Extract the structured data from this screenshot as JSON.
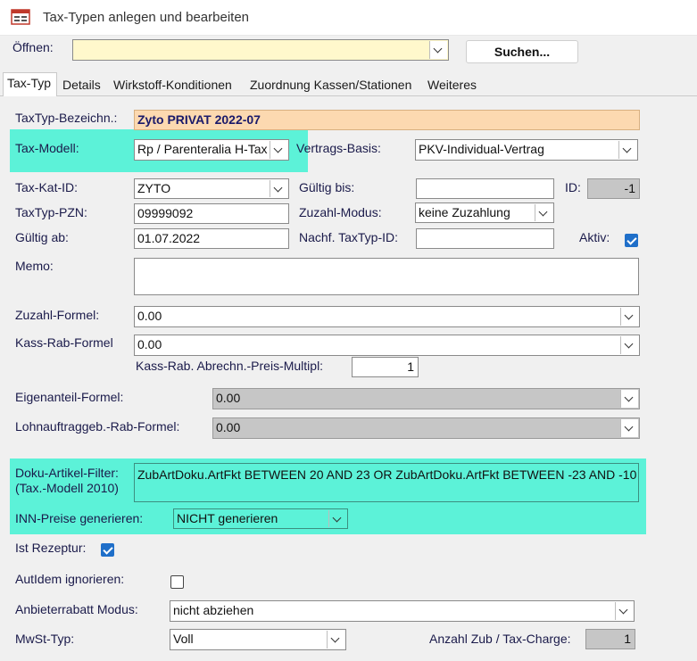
{
  "window": {
    "title": "Tax-Typen anlegen und bearbeiten"
  },
  "toolbar": {
    "open_label": "Öffnen:",
    "open_value": "",
    "search_button": "Suchen..."
  },
  "tabs": [
    {
      "label": "Tax-Typ"
    },
    {
      "label": "Details"
    },
    {
      "label": "Wirkstoff-Konditionen"
    },
    {
      "label": "Zuordnung Kassen/Stationen"
    },
    {
      "label": "Weiteres"
    }
  ],
  "form": {
    "bezeichnung_label": "TaxTyp-Bezeichn.:",
    "bezeichnung_value": "Zyto PRIVAT 2022-07",
    "taxmodell_label": "Tax-Modell:",
    "taxmodell_value": "Rp / Parenteralia H-Tax",
    "vertragsbasis_label": "Vertrags-Basis:",
    "vertragsbasis_value": "PKV-Individual-Vertrag",
    "taxkat_label": "Tax-Kat-ID:",
    "taxkat_value": "ZYTO",
    "gueltigbis_label": "Gültig bis:",
    "gueltigbis_value": "",
    "id_label": "ID:",
    "id_value": "-1",
    "pzn_label": "TaxTyp-PZN:",
    "pzn_value": "09999092",
    "zuzahlmodus_label": "Zuzahl-Modus:",
    "zuzahlmodus_value": "keine Zuzahlung",
    "gueltigab_label": "Gültig ab:",
    "gueltigab_value": "01.07.2022",
    "nachf_label": "Nachf. TaxTyp-ID:",
    "nachf_value": "",
    "aktiv_label": "Aktiv:",
    "memo_label": "Memo:",
    "memo_value": "",
    "zuzahlformel_label": "Zuzahl-Formel:",
    "zuzahlformel_value": "0.00",
    "kassrab_label": "Kass-Rab-Formel",
    "kassrab_value": "0.00",
    "multipl_label": "Kass-Rab. Abrechn.-Preis-Multipl:",
    "multipl_value": "1",
    "eigenanteil_label": "Eigenanteil-Formel:",
    "eigenanteil_value": "0.00",
    "lohnauftrag_label": "Lohnauftraggeb.-Rab-Formel:",
    "lohnauftrag_value": "0.00",
    "doku_label_1": "Doku-Artikel-Filter:",
    "doku_label_2": "(Tax.-Modell 2010)",
    "doku_value": "ZubArtDoku.ArtFkt BETWEEN 20 AND 23 OR ZubArtDoku.ArtFkt BETWEEN -23 AND -10",
    "inn_label": "INN-Preise generieren:",
    "inn_value": "NICHT generieren",
    "rezeptur_label": "Ist Rezeptur:",
    "autidem_label": "AutIdem ignorieren:",
    "anbieterrabatt_label": "Anbieterrabatt Modus:",
    "anbieterrabatt_value": "nicht abziehen",
    "mwst_label": "MwSt-Typ:",
    "mwst_value": "Voll",
    "anzahl_label": "Anzahl Zub / Tax-Charge:",
    "anzahl_value": "1"
  },
  "checkboxes": {
    "aktiv": true,
    "rezeptur": true,
    "autidem": false
  },
  "colors": {
    "highlight": "#5cf2d8",
    "name_field": "#fcd9b0",
    "open_field": "#fff8cc",
    "check_blue": "#1f6fc9"
  }
}
